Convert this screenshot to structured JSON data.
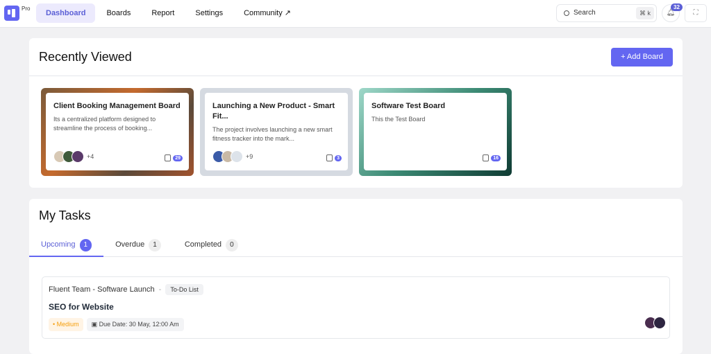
{
  "header": {
    "pro_label": "Pro",
    "nav": [
      "Dashboard",
      "Boards",
      "Report",
      "Settings",
      "Community ↗"
    ],
    "search_placeholder": "Search",
    "shortcut": "⌘ k",
    "notification_count": "32"
  },
  "recent": {
    "title": "Recently Viewed",
    "add_board_label": "+ Add Board",
    "boards": [
      {
        "title": "Client Booking Management Board",
        "description": "Its a centralized platform designed to streamline the process of booking...",
        "more_members": "+4",
        "task_count": "29",
        "bg": "linear-gradient(135deg,#7a5a3a,#c46a2e 40%,#5b4a3a 70%,#a0522d)"
      },
      {
        "title": "Launching a New Product - Smart Fit...",
        "description": "The project involves launching a new smart fitness tracker into the mark...",
        "more_members": "+9",
        "task_count": "3",
        "bg": "#d5dae1"
      },
      {
        "title": "Software Test Board",
        "description": "This the Test Board",
        "more_members": "",
        "task_count": "16",
        "bg": "linear-gradient(135deg,#9fd8c9,#3c8a74 50%,#0f3b33)"
      }
    ]
  },
  "tasks": {
    "title": "My Tasks",
    "tabs": [
      {
        "label": "Upcoming",
        "count": "1"
      },
      {
        "label": "Overdue",
        "count": "1"
      },
      {
        "label": "Completed",
        "count": "0"
      }
    ],
    "items": [
      {
        "project": "Fluent Team - Software Launch",
        "separator": "-",
        "list": "To-Do List",
        "title": "SEO for Website",
        "priority": "• Medium",
        "due": "▣ Due Date:  30 May, 12:00 Am"
      }
    ]
  }
}
